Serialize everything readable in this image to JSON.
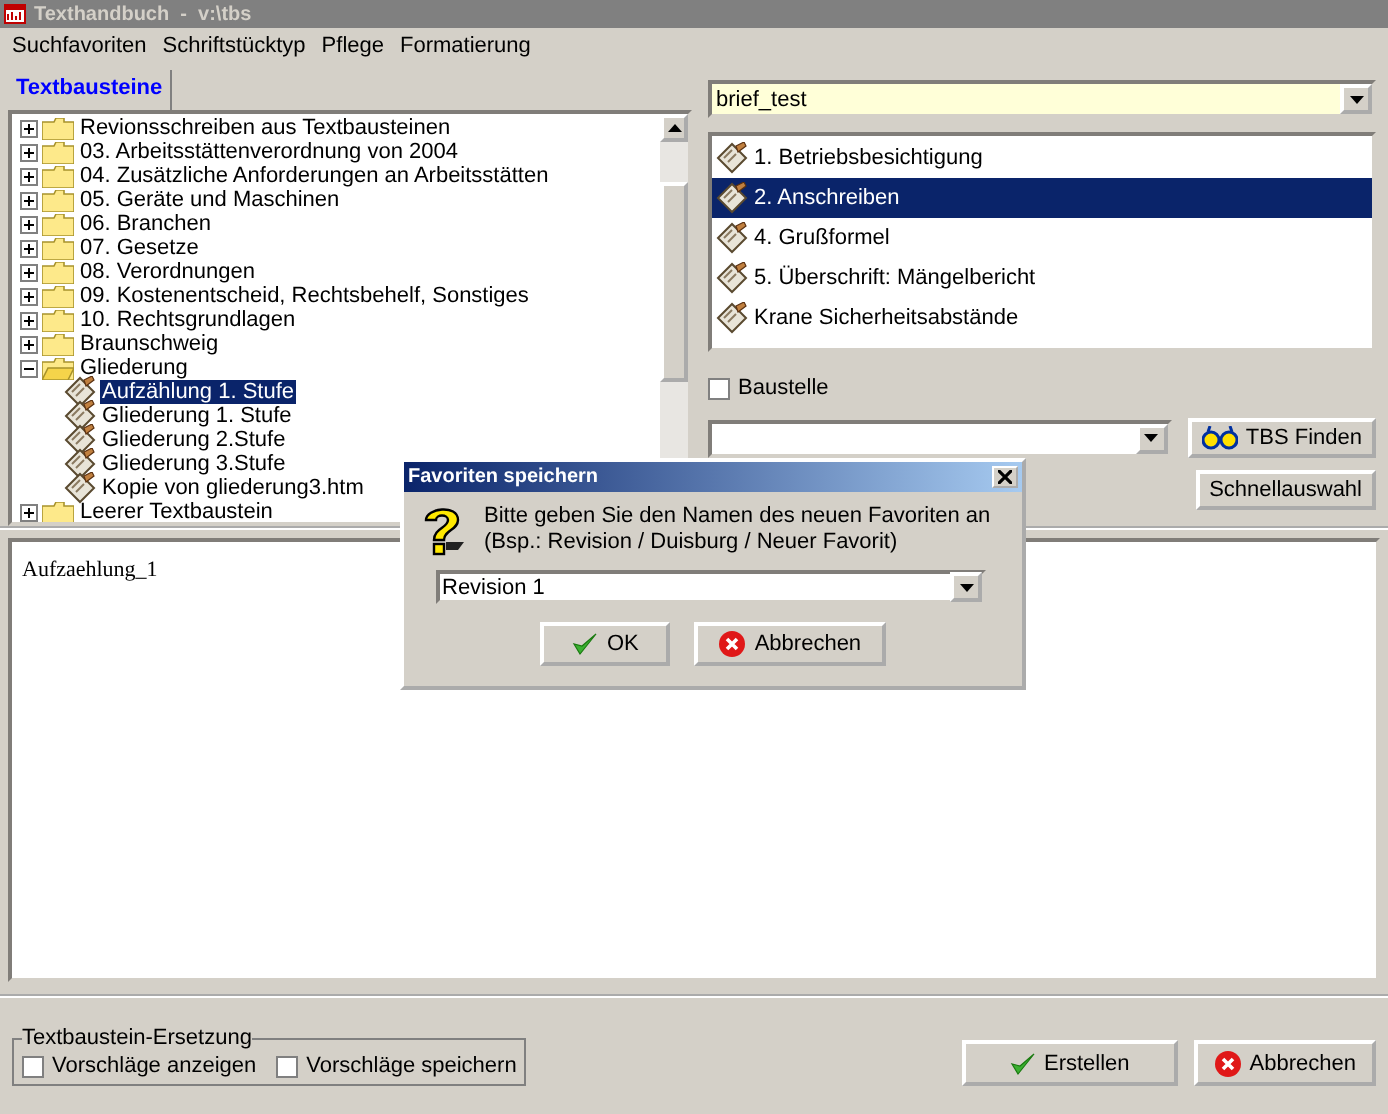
{
  "window": {
    "title": "Texthandbuch  -  v:\\tbs"
  },
  "menu": [
    "Suchfavoriten",
    "Schriftstücktyp",
    "Pflege",
    "Formatierung"
  ],
  "tabs": [
    {
      "label": "Textbausteine",
      "selected": true
    }
  ],
  "tree": [
    {
      "label": "Revionsschreiben aus Textbausteinen",
      "kind": "folder",
      "expanded": false
    },
    {
      "label": "03. Arbeitsstättenverordnung von 2004",
      "kind": "folder",
      "expanded": false
    },
    {
      "label": "04. Zusätzliche Anforderungen an Arbeitsstätten",
      "kind": "folder",
      "expanded": false
    },
    {
      "label": "05. Geräte und Maschinen",
      "kind": "folder",
      "expanded": false
    },
    {
      "label": "06. Branchen",
      "kind": "folder",
      "expanded": false
    },
    {
      "label": "07. Gesetze",
      "kind": "folder",
      "expanded": false
    },
    {
      "label": "08. Verordnungen",
      "kind": "folder",
      "expanded": false
    },
    {
      "label": "09. Kostenentscheid, Rechtsbehelf, Sonstiges",
      "kind": "folder",
      "expanded": false
    },
    {
      "label": "10. Rechtsgrundlagen",
      "kind": "folder",
      "expanded": false
    },
    {
      "label": "Braunschweig",
      "kind": "folder",
      "expanded": false
    },
    {
      "label": "Gliederung",
      "kind": "folder",
      "expanded": true,
      "children": [
        {
          "label": "Aufzählung 1. Stufe",
          "kind": "document",
          "selected": true
        },
        {
          "label": "Gliederung 1. Stufe",
          "kind": "document",
          "selected": false
        },
        {
          "label": "Gliederung 2.Stufe",
          "kind": "document",
          "selected": false
        },
        {
          "label": "Gliederung 3.Stufe",
          "kind": "document",
          "selected": false
        },
        {
          "label": "Kopie von gliederung3.htm",
          "kind": "document",
          "selected": false
        }
      ]
    },
    {
      "label": "Leerer Textbaustein",
      "kind": "folder",
      "expanded": false
    }
  ],
  "letter_combo": {
    "value": "brief_test"
  },
  "letter_items": [
    {
      "label": "1. Betriebsbesichtigung",
      "selected": false
    },
    {
      "label": "2. Anschreiben",
      "selected": true
    },
    {
      "label": "4. Grußformel",
      "selected": false
    },
    {
      "label": "5. Überschrift: Mängelbericht",
      "selected": false
    },
    {
      "label": "Krane Sicherheitsabstände",
      "selected": false
    }
  ],
  "baustelle": {
    "label": "Baustelle",
    "checked": false
  },
  "find_button": "TBS Finden",
  "quick_button": "Schnellauswahl",
  "editor_text": "Aufzaehlung_1",
  "replacement": {
    "title": "Textbaustein-Ersetzung",
    "options": [
      {
        "label": "Vorschläge anzeigen",
        "checked": false
      },
      {
        "label": "Vorschläge speichern",
        "checked": false
      }
    ]
  },
  "buttons": [
    {
      "label": "Erstellen",
      "kind": "ok"
    },
    {
      "label": "Abbrechen",
      "kind": "cancel"
    }
  ],
  "dialog": {
    "title": "Favoriten speichern",
    "message": "Bitte geben Sie den Namen des neuen Favoriten an",
    "example": "(Bsp.: Revision / Duisburg / Neuer Favorit)",
    "value": "Revision 1",
    "buttons": [
      {
        "label": "OK",
        "kind": "ok"
      },
      {
        "label": "Abbrechen",
        "kind": "cancel"
      }
    ]
  }
}
